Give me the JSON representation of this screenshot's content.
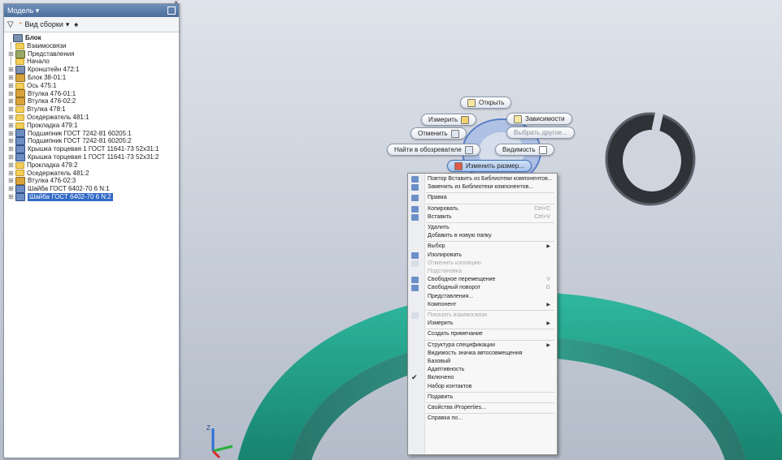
{
  "browser": {
    "title": "Модель ▾",
    "toolbar": {
      "view_label": "Вид сборки",
      "view_dropdown": "▾"
    },
    "tree": [
      {
        "label": "Блок",
        "icon": "asm",
        "root": true
      },
      {
        "label": "Взаимосвязи",
        "icon": "folder",
        "indent": 1
      },
      {
        "label": "Представления",
        "icon": "rep",
        "indent": 1
      },
      {
        "label": "Начало",
        "icon": "folder",
        "indent": 1
      },
      {
        "label": "Кронштейн 472:1",
        "icon": "asm",
        "indent": 1
      },
      {
        "label": "Блок 38-01:1",
        "icon": "part",
        "indent": 1
      },
      {
        "label": "Ось 475:1",
        "icon": "folder",
        "indent": 1
      },
      {
        "label": "Втулка 476-01:1",
        "icon": "part",
        "indent": 1
      },
      {
        "label": "Втулка 476-02:2",
        "icon": "part",
        "indent": 1
      },
      {
        "label": "Втулка 478:1",
        "icon": "folder",
        "indent": 1
      },
      {
        "label": "Оседержатель 481:1",
        "icon": "folder",
        "indent": 1
      },
      {
        "label": "Прокладка 479:1",
        "icon": "folder",
        "indent": 1
      },
      {
        "label": "Подшипник ГОСТ 7242-81 60205:1",
        "icon": "std",
        "indent": 1
      },
      {
        "label": "Подшипник ГОСТ 7242-81 60205:2",
        "icon": "std",
        "indent": 1
      },
      {
        "label": "Крышка торцевая 1 ГОСТ 11641-73 52x31:1",
        "icon": "std",
        "indent": 1
      },
      {
        "label": "Крышка торцевая 1 ГОСТ 11641-73 52x31:2",
        "icon": "std",
        "indent": 1
      },
      {
        "label": "Прокладка 479:2",
        "icon": "folder",
        "indent": 1
      },
      {
        "label": "Оседержатель 481:2",
        "icon": "folder",
        "indent": 1
      },
      {
        "label": "Втулка 476-02:3",
        "icon": "part",
        "indent": 1
      },
      {
        "label": "Шайба ГОСТ 6402-70 6 N:1",
        "icon": "std",
        "indent": 1
      },
      {
        "label": "Шайба ГОСТ 6402-70 6 N:2",
        "icon": "std",
        "indent": 1,
        "selected": true
      }
    ]
  },
  "marking_menu": {
    "open": "Открыть",
    "measure": "Измерить",
    "dependencies": "Зависимости",
    "cancel": "Отменить",
    "select_other": "Выбрать другое...",
    "find_in_browser": "Найти в обозревателе",
    "visibility": "Видимость",
    "change_size": "Изменить размер..."
  },
  "context_menu": {
    "items": [
      {
        "label": "Повтор Вставить из Библиотеки компонентов...",
        "icon": true
      },
      {
        "label": "Заменить из Библиотеки компонентов...",
        "icon": true
      },
      {
        "sep": true
      },
      {
        "label": "Правка",
        "icon": true
      },
      {
        "sep": true
      },
      {
        "label": "Копировать",
        "shortcut": "Ctrl+C",
        "icon": true
      },
      {
        "label": "Вставить",
        "shortcut": "Ctrl+V",
        "icon": true
      },
      {
        "sep": true
      },
      {
        "label": "Удалить"
      },
      {
        "label": "Добавить в новую папку"
      },
      {
        "sep": true
      },
      {
        "label": "Выбор",
        "submenu": true
      },
      {
        "label": "Изолировать",
        "icon": true
      },
      {
        "label": "Отменить изоляцию",
        "disabled": true,
        "icon": true
      },
      {
        "label": "Подстановка",
        "disabled": true
      },
      {
        "label": "Свободное перемещение",
        "shortcut": "V",
        "icon": true
      },
      {
        "label": "Свободный поворот",
        "shortcut": "G",
        "icon": true
      },
      {
        "label": "Представления..."
      },
      {
        "label": "Компонент",
        "submenu": true
      },
      {
        "sep": true
      },
      {
        "label": "Показать взаимосвязи",
        "disabled": true,
        "icon": true
      },
      {
        "label": "Измерить",
        "submenu": true
      },
      {
        "sep": true
      },
      {
        "label": "Создать примечание"
      },
      {
        "sep": true
      },
      {
        "label": "Структура спецификации",
        "submenu": true
      },
      {
        "label": "Видимость значка автосовмещения"
      },
      {
        "label": "Базовый"
      },
      {
        "label": "Адаптивность"
      },
      {
        "label": "Включено",
        "checked": true
      },
      {
        "label": "Набор контактов"
      },
      {
        "sep": true
      },
      {
        "label": "Подавить"
      },
      {
        "sep": true
      },
      {
        "label": "Свойства iProperties..."
      },
      {
        "sep": true
      },
      {
        "label": "Справка по..."
      }
    ]
  },
  "colors": {
    "accent_blue": "#3169c6",
    "model_teal": "#1f9e88",
    "ring_dark": "#3c3f44"
  },
  "icons": {
    "filter": "filter-icon",
    "search": "binoculars-icon",
    "pin": "pin-icon",
    "close": "close-icon"
  },
  "triad_label": "Z"
}
